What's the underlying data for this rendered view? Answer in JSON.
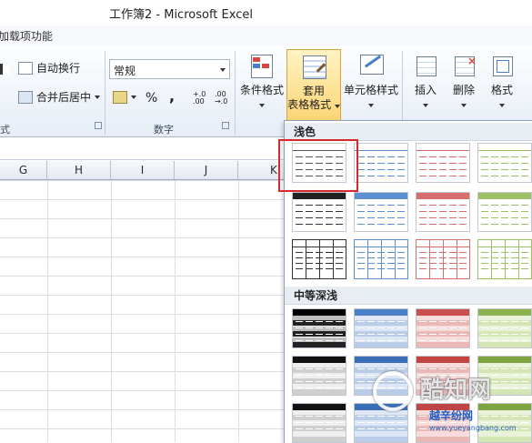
{
  "window": {
    "title": "工作簿2 - Microsoft Excel"
  },
  "tabs": {
    "current_fragment": "加载项功能"
  },
  "ribbon": {
    "align_group": {
      "wrap_text": "自动换行",
      "merge_center": "合并后居中",
      "label_fragment": "式"
    },
    "number_group": {
      "format_value": "常规",
      "percent": "%",
      "comma": ",",
      "inc_decimal": "+.0 .00",
      "dec_decimal": ".00 →.0",
      "label": "数字"
    },
    "styles_group": {
      "conditional": "条件格式",
      "table_format_line1": "套用",
      "table_format_line2": "表格格式",
      "cell_styles": "单元格样式"
    },
    "cells_group": {
      "insert": "插入",
      "delete": "删除",
      "format": "格式"
    }
  },
  "columns": [
    "G",
    "H",
    "I",
    "J",
    "K"
  ],
  "gallery": {
    "section_light": "浅色",
    "section_medium": "中等深浅",
    "swatches": [
      "#6f6f6f",
      "#5b8fd0",
      "#d76e6e",
      "#9cc064"
    ]
  },
  "watermark": {
    "brand": "酷知网",
    "site": "越辛纷网",
    "url": "www.yueyangbang.com"
  }
}
